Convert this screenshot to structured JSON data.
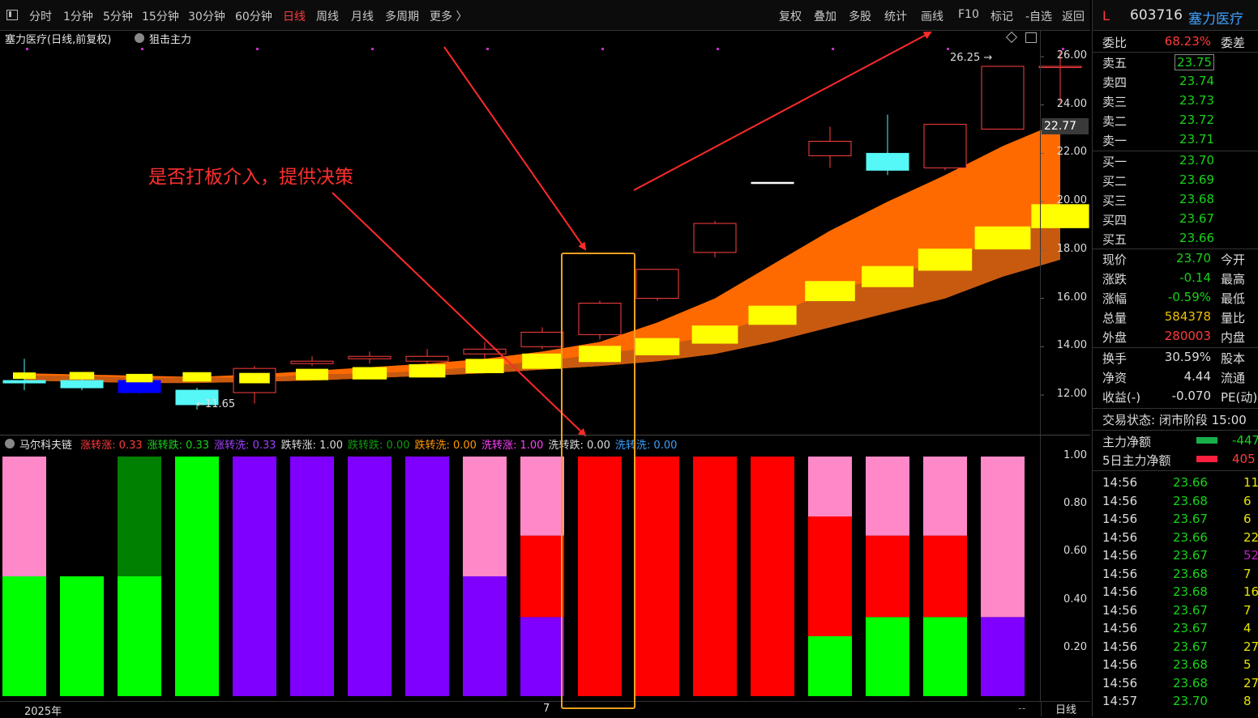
{
  "toolbar": {
    "periods": [
      "分时",
      "1分钟",
      "5分钟",
      "15分钟",
      "30分钟",
      "60分钟",
      "日线",
      "周线",
      "月线",
      "多周期",
      "更多 〉"
    ],
    "active_period": "日线",
    "tools": [
      "复权",
      "叠加",
      "多股",
      "统计",
      "画线",
      "F10",
      "标记",
      "-自选",
      "返回"
    ]
  },
  "main_chart": {
    "title": "塞力医疗(日线,前复权)",
    "indicator": "狙击主力",
    "annotation": "是否打板介入，提供决策",
    "high_label": "26.25",
    "low_label": "←11.65",
    "current_price_tag": "22.77",
    "y_ticks": [
      "26.00",
      "24.00",
      "22.00",
      "20.00",
      "18.00",
      "16.00",
      "14.00",
      "12.00"
    ],
    "candles": [
      {
        "o": 12.6,
        "c": 12.5,
        "h": 13.5,
        "l": 12.2,
        "color": "#55f7f7"
      },
      {
        "o": 12.6,
        "c": 12.3,
        "h": 12.7,
        "l": 12.2,
        "color": "#55f7f7"
      },
      {
        "o": 12.6,
        "c": 12.1,
        "h": 12.8,
        "l": 12.0,
        "color": "#0000ff"
      },
      {
        "o": 12.2,
        "c": 11.6,
        "h": 12.3,
        "l": 11.4,
        "color": "#55f7f7"
      },
      {
        "o": 12.1,
        "c": 13.1,
        "h": 13.2,
        "l": 11.65,
        "color": "#ff4040"
      },
      {
        "o": 13.3,
        "c": 13.4,
        "h": 13.6,
        "l": 13.2,
        "color": "#ff4040"
      },
      {
        "o": 13.5,
        "c": 13.6,
        "h": 13.8,
        "l": 13.3,
        "color": "#ff4040"
      },
      {
        "o": 13.4,
        "c": 13.6,
        "h": 13.9,
        "l": 13.3,
        "color": "#ff4040"
      },
      {
        "o": 13.7,
        "c": 13.9,
        "h": 14.2,
        "l": 13.5,
        "color": "#ff4040"
      },
      {
        "o": 14.0,
        "c": 14.6,
        "h": 14.8,
        "l": 13.9,
        "color": "#ff4040"
      },
      {
        "o": 14.5,
        "c": 15.8,
        "h": 15.9,
        "l": 14.3,
        "color": "#ff4040"
      },
      {
        "o": 16.0,
        "c": 17.2,
        "h": 17.2,
        "l": 15.9,
        "color": "#ff4040"
      },
      {
        "o": 17.9,
        "c": 19.1,
        "h": 19.2,
        "l": 17.7,
        "color": "#ff4040"
      },
      {
        "o": 20.8,
        "c": 20.8,
        "h": 20.8,
        "l": 20.8,
        "color": "#ffffff"
      },
      {
        "o": 21.9,
        "c": 22.5,
        "h": 23.1,
        "l": 21.4,
        "color": "#ff4040"
      },
      {
        "o": 22.0,
        "c": 21.3,
        "h": 23.6,
        "l": 21.1,
        "color": "#55f7f7"
      },
      {
        "o": 21.4,
        "c": 23.2,
        "h": 23.2,
        "l": 21.3,
        "color": "#ff4040"
      },
      {
        "o": 23.0,
        "c": 25.6,
        "h": 25.6,
        "l": 23.0,
        "color": "#ff4040"
      },
      {
        "o": 25.6,
        "c": 25.6,
        "h": 26.25,
        "l": 24.1,
        "color": "#ff4040"
      }
    ],
    "band_upper": [
      12.9,
      12.85,
      12.8,
      12.75,
      12.85,
      13.0,
      13.15,
      13.3,
      13.5,
      13.8,
      14.2,
      15.0,
      16.0,
      17.4,
      18.8,
      20.0,
      21.1,
      22.3,
      23.3
    ],
    "band_lower": [
      12.6,
      12.55,
      12.5,
      12.5,
      12.55,
      12.6,
      12.7,
      12.8,
      12.9,
      13.05,
      13.2,
      13.4,
      13.7,
      14.2,
      14.8,
      15.4,
      16.0,
      16.9,
      17.6
    ],
    "markers": [
      12.8,
      12.8,
      12.7,
      12.75,
      12.7,
      12.85,
      12.9,
      13.0,
      13.2,
      13.4,
      13.7,
      14.0,
      14.5,
      15.3,
      16.3,
      16.9,
      17.6,
      18.5,
      19.4
    ]
  },
  "sub_chart": {
    "name": "马尔科夫链",
    "legend": [
      {
        "label": "涨转涨: 0.33",
        "color": "#ff3b3b"
      },
      {
        "label": "涨转跌: 0.33",
        "color": "#19d219"
      },
      {
        "label": "涨转洗: 0.33",
        "color": "#a040ff"
      },
      {
        "label": "跌转涨: 1.00",
        "color": "#dddddd"
      },
      {
        "label": "跌转跌: 0.00",
        "color": "#119911"
      },
      {
        "label": "跌转洗: 0.00",
        "color": "#ff9900"
      },
      {
        "label": "洗转涨: 1.00",
        "color": "#ff40ff"
      },
      {
        "label": "洗转跌: 0.00",
        "color": "#dddddd"
      },
      {
        "label": "洗转洗: 0.00",
        "color": "#3aa0ff"
      }
    ],
    "y_ticks": [
      "1.00",
      "0.80",
      "0.60",
      "0.40",
      "0.20"
    ],
    "bars": [
      [
        {
          "v": 0.5,
          "c": "#00ff00"
        },
        {
          "v": 0.5,
          "c": "#ff88c8"
        }
      ],
      [
        {
          "v": 0.5,
          "c": "#00ff00"
        }
      ],
      [
        {
          "v": 0.5,
          "c": "#00ff00"
        },
        {
          "v": 0.5,
          "c": "#008000"
        }
      ],
      [
        {
          "v": 1.0,
          "c": "#00ff00"
        }
      ],
      [
        {
          "v": 1.0,
          "c": "#8000ff"
        }
      ],
      [
        {
          "v": 1.0,
          "c": "#8000ff"
        }
      ],
      [
        {
          "v": 1.0,
          "c": "#8000ff"
        }
      ],
      [
        {
          "v": 1.0,
          "c": "#8000ff"
        }
      ],
      [
        {
          "v": 0.5,
          "c": "#8000ff"
        },
        {
          "v": 0.5,
          "c": "#ff88c8"
        }
      ],
      [
        {
          "v": 0.33,
          "c": "#8000ff"
        },
        {
          "v": 0.34,
          "c": "#ff0000"
        },
        {
          "v": 0.33,
          "c": "#ff88c8"
        }
      ],
      [
        {
          "v": 1.0,
          "c": "#ff0000"
        }
      ],
      [
        {
          "v": 1.0,
          "c": "#ff0000"
        }
      ],
      [
        {
          "v": 1.0,
          "c": "#ff0000"
        }
      ],
      [
        {
          "v": 1.0,
          "c": "#ff0000"
        }
      ],
      [
        {
          "v": 0.25,
          "c": "#00ff00"
        },
        {
          "v": 0.5,
          "c": "#ff0000"
        },
        {
          "v": 0.25,
          "c": "#ff88c8"
        }
      ],
      [
        {
          "v": 0.33,
          "c": "#00ff00"
        },
        {
          "v": 0.34,
          "c": "#ff0000"
        },
        {
          "v": 0.33,
          "c": "#ff88c8"
        }
      ],
      [
        {
          "v": 0.33,
          "c": "#00ff00"
        },
        {
          "v": 0.34,
          "c": "#ff0000"
        },
        {
          "v": 0.33,
          "c": "#ff88c8"
        }
      ],
      [
        {
          "v": 0.33,
          "c": "#8000ff"
        },
        {
          "v": 0.67,
          "c": "#ff88c8"
        }
      ]
    ]
  },
  "bottom_axis": {
    "year": "2025年",
    "month": "7",
    "period_button": "日线",
    "dash": "--"
  },
  "quote": {
    "marker": "L",
    "code": "603716",
    "name": "塞力医疗",
    "weibi_label": "委比",
    "weibi_value": "68.23%",
    "weicha_label": "委差",
    "asks": [
      {
        "label": "卖五",
        "price": "23.75"
      },
      {
        "label": "卖四",
        "price": "23.74"
      },
      {
        "label": "卖三",
        "price": "23.73"
      },
      {
        "label": "卖二",
        "price": "23.72"
      },
      {
        "label": "卖一",
        "price": "23.71"
      }
    ],
    "bids": [
      {
        "label": "买一",
        "price": "23.70"
      },
      {
        "label": "买二",
        "price": "23.69"
      },
      {
        "label": "买三",
        "price": "23.68"
      },
      {
        "label": "买四",
        "price": "23.67"
      },
      {
        "label": "买五",
        "price": "23.66"
      }
    ],
    "stats1": [
      {
        "label": "现价",
        "value": "23.70",
        "cls": "green",
        "label2": "今开"
      },
      {
        "label": "涨跌",
        "value": "-0.14",
        "cls": "green",
        "label2": "最高"
      },
      {
        "label": "涨幅",
        "value": "-0.59%",
        "cls": "green",
        "label2": "最低"
      },
      {
        "label": "总量",
        "value": "584378",
        "cls": "gold",
        "label2": "量比"
      },
      {
        "label": "外盘",
        "value": "280003",
        "cls": "red",
        "label2": "内盘"
      }
    ],
    "stats2": [
      {
        "label": "换手",
        "value": "30.59%",
        "cls": "",
        "label2": "股本"
      },
      {
        "label": "净资",
        "value": "4.44",
        "cls": "",
        "label2": "流通"
      },
      {
        "label": "收益(-)",
        "value": "-0.070",
        "cls": "",
        "label2": "PE(动)"
      }
    ],
    "trade_status": "交易状态: 闭市阶段 15:00",
    "flow": [
      {
        "label": "主力净额",
        "value": "-447",
        "cls": "green",
        "bar": "#19b04a"
      },
      {
        "label": "5日主力净额",
        "value": "405",
        "cls": "red",
        "bar": "#ff2040"
      }
    ],
    "ticks": [
      {
        "t": "14:56",
        "p": "23.66",
        "v": "11",
        "vc": "yellow"
      },
      {
        "t": "14:56",
        "p": "23.68",
        "v": "6",
        "vc": "yellow"
      },
      {
        "t": "14:56",
        "p": "23.67",
        "v": "6",
        "vc": "yellow"
      },
      {
        "t": "14:56",
        "p": "23.66",
        "v": "22",
        "vc": "yellow"
      },
      {
        "t": "14:56",
        "p": "23.67",
        "v": "52",
        "vc": "purple"
      },
      {
        "t": "14:56",
        "p": "23.68",
        "v": "7",
        "vc": "yellow"
      },
      {
        "t": "14:56",
        "p": "23.68",
        "v": "16",
        "vc": "yellow"
      },
      {
        "t": "14:56",
        "p": "23.67",
        "v": "7",
        "vc": "yellow"
      },
      {
        "t": "14:56",
        "p": "23.67",
        "v": "4",
        "vc": "yellow"
      },
      {
        "t": "14:56",
        "p": "23.67",
        "v": "27",
        "vc": "yellow"
      },
      {
        "t": "14:56",
        "p": "23.68",
        "v": "5",
        "vc": "yellow"
      },
      {
        "t": "14:56",
        "p": "23.68",
        "v": "27",
        "vc": "yellow"
      },
      {
        "t": "14:57",
        "p": "23.70",
        "v": "8",
        "vc": "yellow"
      }
    ]
  }
}
